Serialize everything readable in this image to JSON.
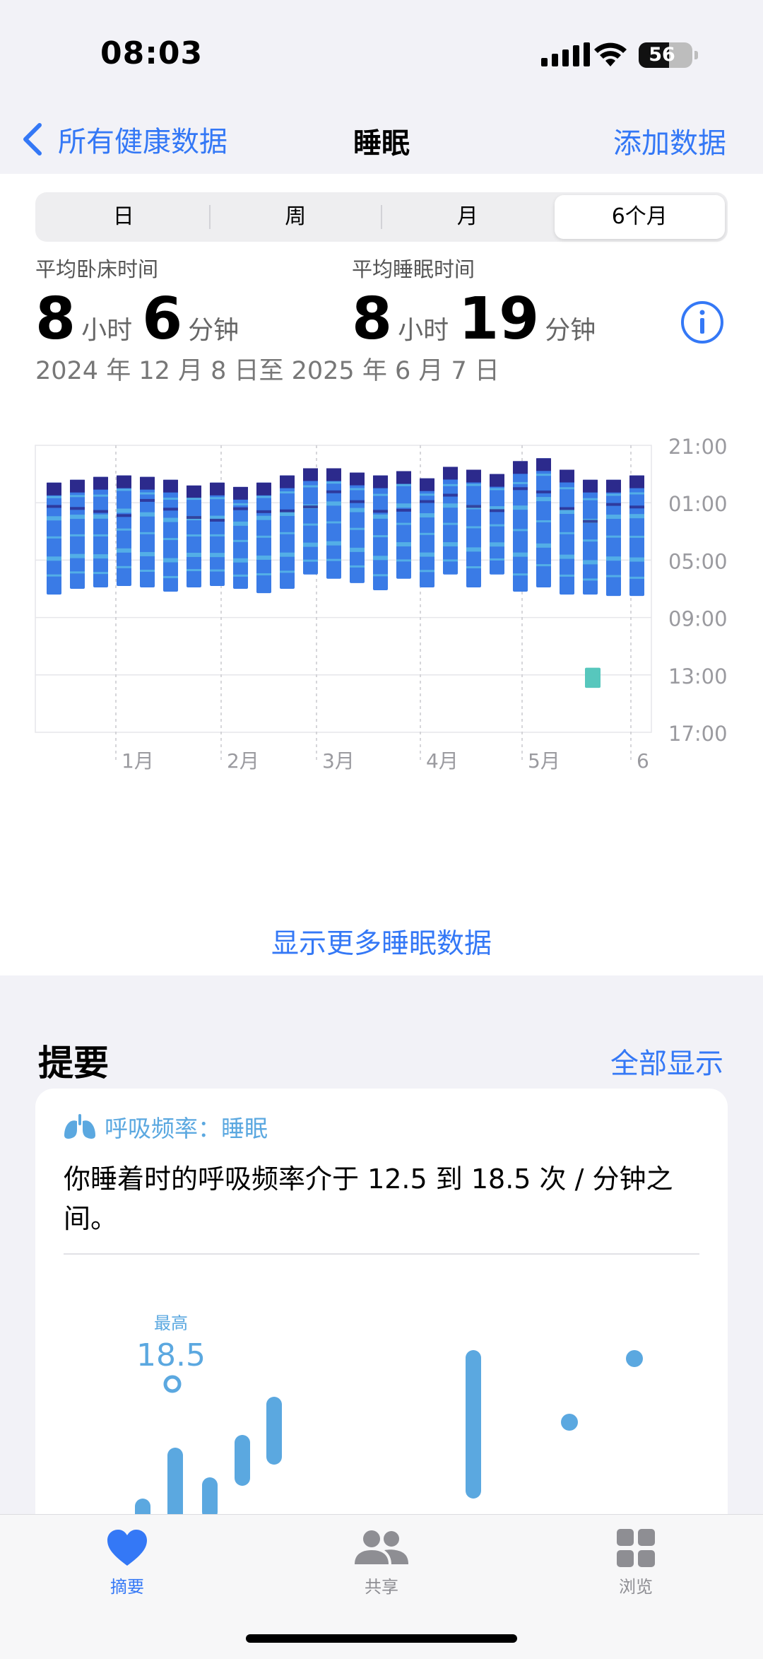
{
  "status_bar": {
    "time": "08:03",
    "battery_level": "56",
    "battery_fraction": 0.56
  },
  "nav": {
    "back_label": "所有健康数据",
    "title": "睡眠",
    "add_label": "添加数据"
  },
  "segments": [
    {
      "label": "日",
      "active": false
    },
    {
      "label": "周",
      "active": false
    },
    {
      "label": "月",
      "active": false
    },
    {
      "label": "6个月",
      "active": true
    }
  ],
  "stats": {
    "in_bed": {
      "label": "平均卧床时间",
      "hours": "8",
      "hours_unit": "小时",
      "minutes": "6",
      "minutes_unit": "分钟"
    },
    "asleep": {
      "label": "平均睡眠时间",
      "hours": "8",
      "hours_unit": "小时",
      "minutes": "19",
      "minutes_unit": "分钟"
    },
    "date_range": "2024 年 12 月 8 日至 2025 年 6 月 7 日"
  },
  "chart_data": [
    {
      "type": "bar",
      "y_axis_labels": [
        "21:00",
        "01:00",
        "05:00",
        "09:00",
        "13:00",
        "17:00"
      ],
      "ylim": [
        "21:00",
        "17:00"
      ],
      "x_axis_labels": [
        "1月",
        "2月",
        "3月",
        "4月",
        "5月",
        "6"
      ],
      "grid": true,
      "series": [
        {
          "start": [
            23.6,
            23.4,
            23.2,
            23.1,
            23.2,
            23.4,
            23.8,
            23.6,
            23.9,
            23.6,
            23.1,
            22.6,
            22.6,
            22.9,
            23.1,
            22.8,
            23.3,
            22.5,
            22.7,
            23.0,
            22.1,
            21.9,
            22.7,
            23.4,
            23.4,
            23.1
          ],
          "end": [
            7.4,
            7.0,
            6.9,
            6.8,
            6.9,
            7.2,
            6.9,
            6.8,
            7.0,
            7.3,
            7.0,
            6.0,
            6.3,
            6.6,
            7.1,
            6.3,
            6.9,
            6.0,
            6.9,
            6.0,
            7.2,
            6.9,
            7.4,
            7.4,
            7.5
          ]
        }
      ],
      "extra_block": {
        "start": 12.5,
        "end": 13.9
      },
      "colors": {
        "core": "#3a7be6",
        "deep": "#2c2a8c",
        "rem": "#58b7e6",
        "awake": "#e07a5f",
        "nap": "#57c7bd"
      }
    },
    {
      "type": "bar",
      "title": "呼吸频率：睡眠",
      "annotation_label": "最高",
      "annotation_value": "18.5",
      "range_min": 12.5,
      "range_max": 18.5,
      "ranges": [
        [
          14.0,
          15.3
        ],
        [
          14.5,
          16.0
        ],
        [
          15.0,
          17.2
        ],
        [
          15.5,
          16.5
        ],
        [
          16.3,
          17.5
        ],
        [
          16.8,
          18.4
        ],
        [
          11.5,
          13.5
        ],
        [
          13.0,
          14.2
        ],
        [
          12.0,
          14.0
        ],
        [
          13.2,
          15.0
        ],
        [
          12.0,
          13.0
        ],
        [
          16.0,
          19.5
        ],
        [
          12.0,
          13.5
        ],
        [
          17.8,
          17.8
        ],
        [
          19.3,
          19.3
        ]
      ],
      "color": "#5ba8e0"
    }
  ],
  "show_more": "显示更多睡眠数据",
  "summary": {
    "title": "提要",
    "show_all": "全部显示",
    "card_title": "呼吸频率：睡眠",
    "card_text": "你睡着时的呼吸频率介于 12.5 到 18.5 次 / 分钟之间。"
  },
  "tabs": [
    {
      "label": "摘要",
      "icon": "heart-icon",
      "active": true
    },
    {
      "label": "共享",
      "icon": "people-icon",
      "active": false
    },
    {
      "label": "浏览",
      "icon": "grid-icon",
      "active": false
    }
  ]
}
